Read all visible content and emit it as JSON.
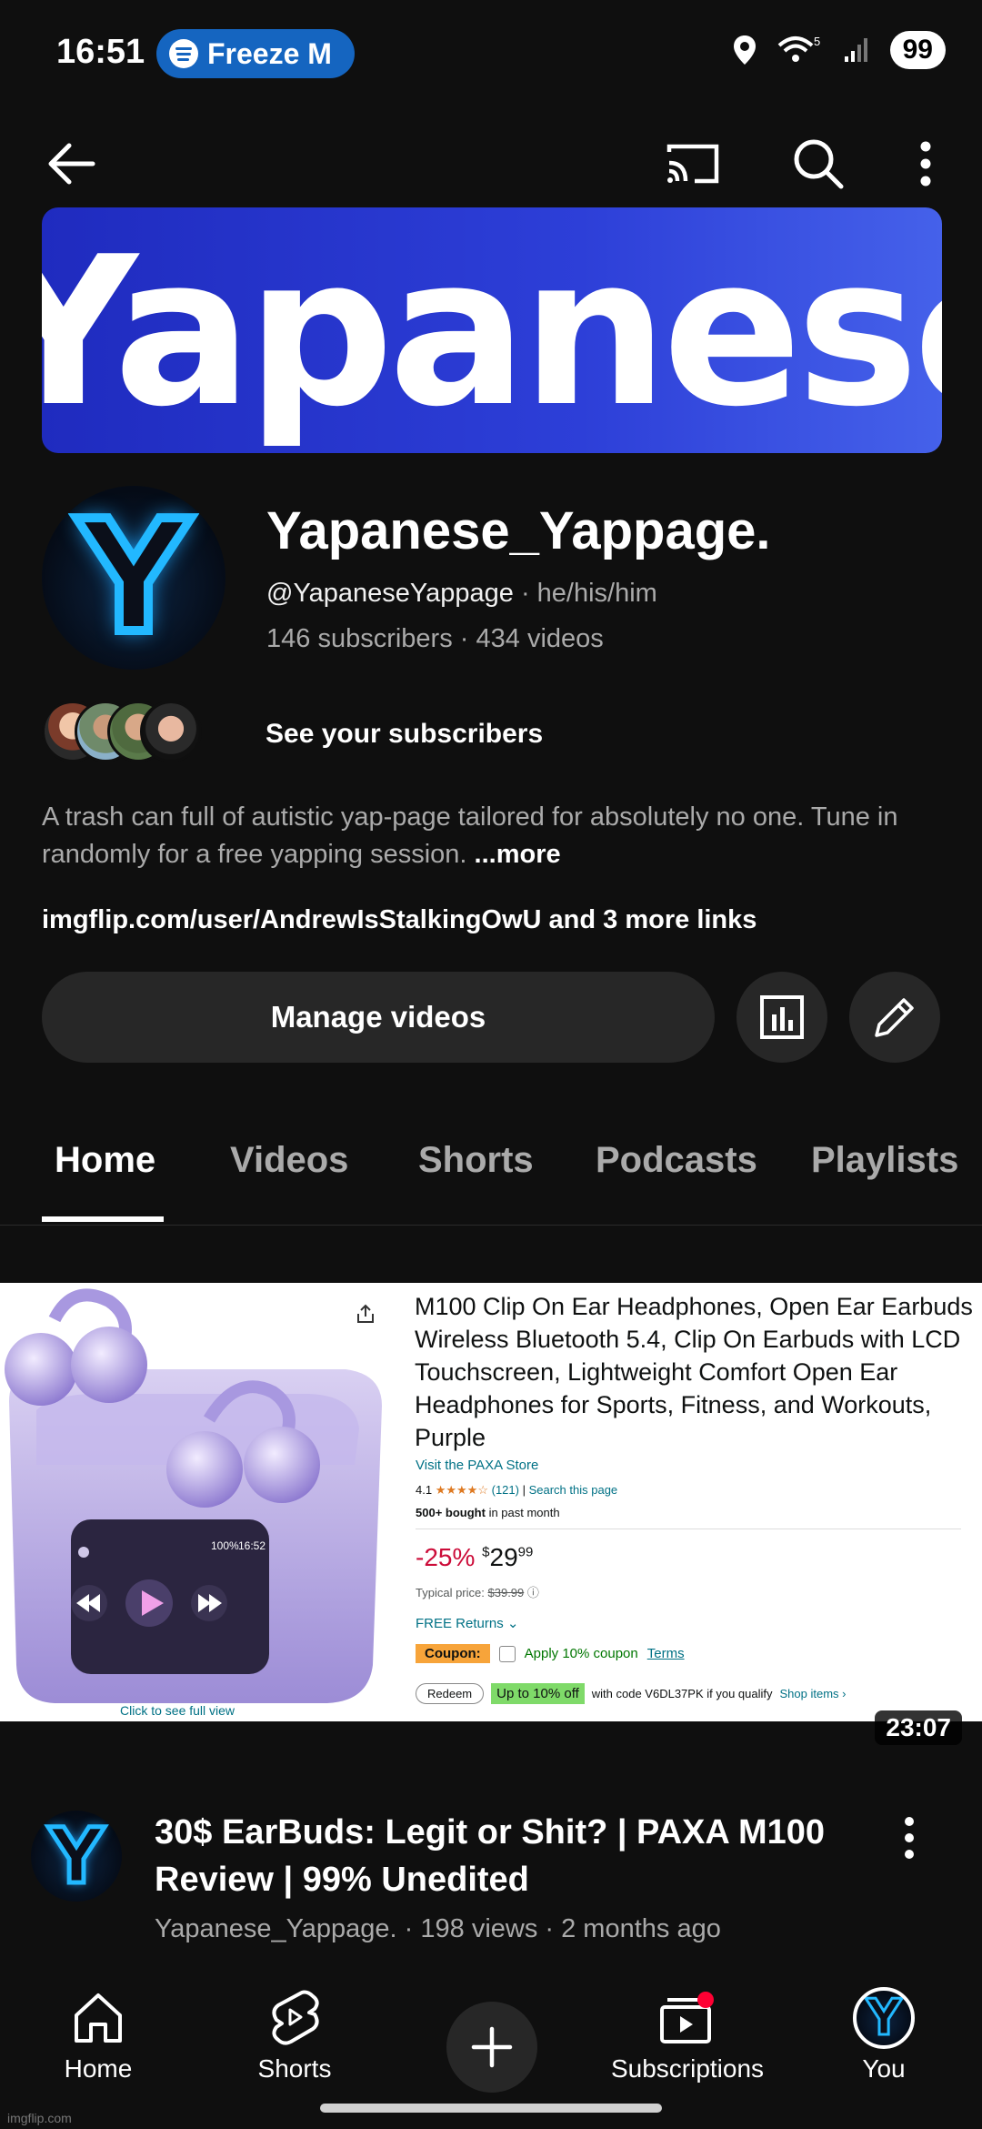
{
  "status_bar": {
    "time": "16:51",
    "now_playing": "Freeze M",
    "signal_label": "5",
    "battery": "99"
  },
  "app_bar": {
    "back_icon": "arrow-left-icon",
    "cast_icon": "cast-icon",
    "search_icon": "search-icon",
    "menu_icon": "more-vert-icon"
  },
  "banner": {
    "text": "Yapanese"
  },
  "channel": {
    "avatar_letter": "Y",
    "name": "Yapanese_Yappage.",
    "handle": "@YapaneseYappage",
    "pronouns": "he/his/him",
    "subscribers": "146 subscribers",
    "videos": "434 videos",
    "see_subscribers": "See your subscribers",
    "description": "A trash can full of autistic yap-page tailored for absolutely no one. Tune in randomly for a free yapping session.",
    "more_label": "...more",
    "links": "imgflip.com/user/AndrewIsStalkingOwU and 3 more links",
    "manage_videos": "Manage videos"
  },
  "tabs": [
    {
      "label": "Home",
      "active": true
    },
    {
      "label": "Videos",
      "active": false
    },
    {
      "label": "Shorts",
      "active": false
    },
    {
      "label": "Podcasts",
      "active": false
    },
    {
      "label": "Playlists",
      "active": false
    }
  ],
  "thumbnail": {
    "product_title": "M100 Clip On Ear Headphones, Open Ear Earbuds Wireless Bluetooth 5.4, Clip On Earbuds with LCD Touchscreen, Lightweight Comfort Open Ear Headphones for Sports, Fitness, and Workouts, Purple",
    "store": "Visit the PAXA Store",
    "rating": "4.1",
    "stars": "★★★★☆",
    "reviews": "(121)",
    "search_page": "Search this page",
    "bought_bold": "500+ bought",
    "bought_rest": "in past month",
    "discount": "-25%",
    "price_symbol": "$",
    "price_whole": "29",
    "price_fraction": "99",
    "typical_label": "Typical price:",
    "typical_price": "$39.99",
    "returns": "FREE Returns",
    "coupon_tag": "Coupon:",
    "coupon_text": "Apply 10% coupon",
    "terms": "Terms",
    "redeem": "Redeem",
    "up_to": "Up to 10% off",
    "code_text": "with code V6DL37PK if you qualify",
    "shop_items": "Shop items ›",
    "click_full": "Click to see full view",
    "screen_battery": "100%",
    "screen_time": "16:52"
  },
  "video": {
    "duration": "23:07",
    "avatar_letter": "Y",
    "title": "30$ EarBuds: Legit or Shit? | PAXA M100 Review | 99% Unedited",
    "meta": "Yapanese_Yappage. · 198 views · 2 months ago"
  },
  "bottom_nav": {
    "home": "Home",
    "shorts": "Shorts",
    "subscriptions": "Subscriptions",
    "you": "You",
    "you_letter": "Y"
  },
  "watermark": "imgflip.com",
  "colors": {
    "background": "#0f0f0f",
    "chip": "#272727",
    "accent_blue": "#1565c0",
    "banner_blue": "#2d3fd8",
    "neon_blue": "#22b8ff",
    "notification_red": "#ff0033"
  }
}
